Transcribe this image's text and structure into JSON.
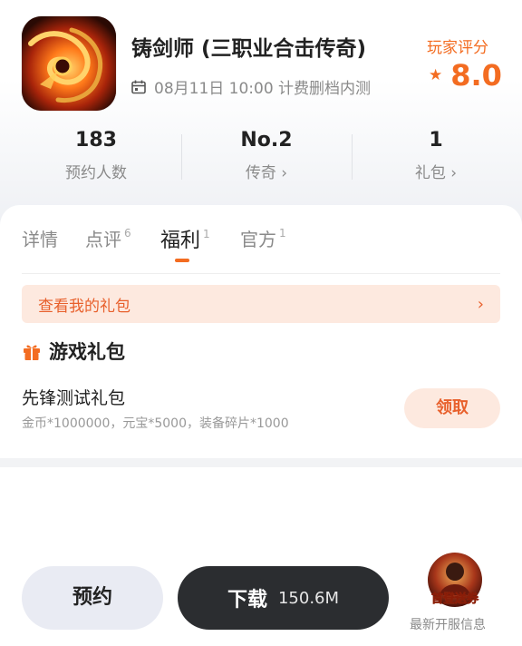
{
  "header": {
    "title": "铸剑师 (三职业合击传奇)",
    "schedule": "08月11日 10:00 计费删档内测",
    "rating_label": "玩家评分",
    "rating": "8.0"
  },
  "stats": [
    {
      "value": "183",
      "label": "预约人数"
    },
    {
      "value": "No.2",
      "label": "传奇 ›"
    },
    {
      "value": "1",
      "label": "礼包 ›"
    }
  ],
  "tabs": [
    {
      "label": "详情",
      "count": ""
    },
    {
      "label": "点评",
      "count": "6"
    },
    {
      "label": "福利",
      "count": "1"
    },
    {
      "label": "官方",
      "count": "1"
    }
  ],
  "gift_bar": {
    "text": "查看我的礼包",
    "arrow": "›"
  },
  "gift_section": {
    "title": "游戏礼包",
    "pack_name": "先锋测试礼包",
    "pack_desc": "金币*1000000，元宝*5000，装备碎片*1000",
    "claim": "领取"
  },
  "footer": {
    "reserve": "预约",
    "download": "下载",
    "size": "150.6M",
    "server_badge": "首登送券",
    "server_info": "最新开服信息"
  },
  "colors": {
    "accent": "#f36c21",
    "dark_button": "#2b2d30",
    "soft_orange": "#fde9df"
  },
  "icons": [
    "calendar-icon",
    "star-icon",
    "gift-icon",
    "chevron-right-icon"
  ]
}
